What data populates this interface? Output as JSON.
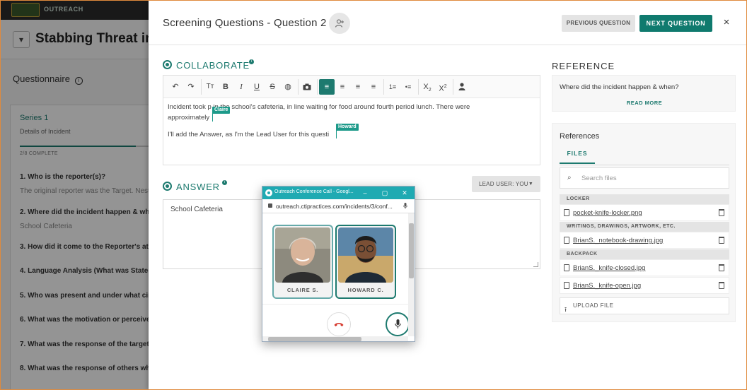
{
  "background": {
    "brand": "OUTREACH",
    "title": "Stabbing Threat in I",
    "questionnaire_label": "Questionnaire",
    "series": {
      "title": "Series 1",
      "subtitle": "Details of Incident",
      "progress": "2/8 COMPLETE",
      "progress_fraction": 0.25
    },
    "questions": [
      {
        "q": "1. Who is the reporter(s)?",
        "a": "The original reporter was the Target. Nest"
      },
      {
        "q": "2. Where did the incident happen & wh",
        "a": "School Cafeteria"
      },
      {
        "q": "3. How did it come to the Reporter's att",
        "a": ""
      },
      {
        "q": "4. Language Analysis (What was Stated",
        "a": ""
      },
      {
        "q": "5. Who was present and under what cir",
        "a": ""
      },
      {
        "q": "6. What was the motivation or perceive",
        "a": ""
      },
      {
        "q": "7. What was the response of the target",
        "a": ""
      },
      {
        "q": "8. What was the response of others whe",
        "a": ""
      }
    ]
  },
  "drawer": {
    "title": "Screening Questions - Question 2",
    "prev_label": "PREVIOUS QUESTION",
    "next_label": "NEXT QUESTION",
    "close_label": "×"
  },
  "collaborate": {
    "title": "COLLABORATE",
    "line1_before": "Incident took p",
    "line1_after": "in the school's cafeteria, in line waiting for food around fourth period lunch. There were",
    "line2": "approximately",
    "line3": "I'll add the Answer, as I'm the Lead User for this questi",
    "cursors": [
      {
        "name": "Claire"
      },
      {
        "name": "Howard"
      }
    ]
  },
  "answer": {
    "title": "ANSWER",
    "lead_user_label": "LEAD USER: YOU",
    "value": "School Cafeteria"
  },
  "reference": {
    "title": "REFERENCE",
    "question": "Where did the incident happen & when?",
    "read_more": "READ MORE"
  },
  "references": {
    "title": "References",
    "tab": "FILES",
    "search_placeholder": "Search files",
    "groups": [
      {
        "name": "LOCKER",
        "files": [
          "pocket-knife-locker.png"
        ]
      },
      {
        "name": "WRITINGS, DRAWINGS, ARTWORK, ETC.",
        "files": [
          "BrianS._notebook-drawing.jpg"
        ]
      },
      {
        "name": "BACKPACK",
        "files": [
          "BrianS._knife-closed.jpg",
          "BrianS._knife-open.jpg"
        ]
      }
    ],
    "upload_label": "UPLOAD FILE"
  },
  "popup": {
    "window_title": "Outreach Conference Call - Googl...",
    "url": "outreach.ctipractices.com/incidents/3/conf...",
    "participants": [
      {
        "name": "CLAIRE S."
      },
      {
        "name": "HOWARD C."
      }
    ]
  },
  "colors": {
    "accent": "#1d7a6f",
    "popup_titlebar": "#1faab2",
    "hangup": "#d63a2f"
  }
}
